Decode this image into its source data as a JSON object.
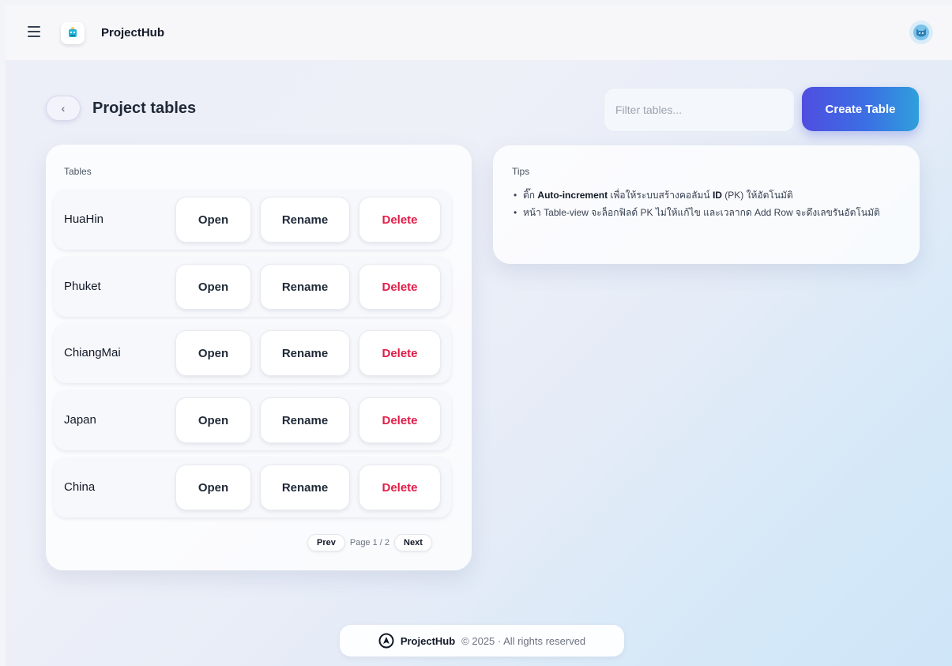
{
  "app": {
    "brand": "ProjectHub"
  },
  "header": {
    "title": "Project tables",
    "back_label": "‹",
    "filter_placeholder": "Filter tables...",
    "create_label": "Create Table"
  },
  "tables_card": {
    "label": "Tables",
    "rows": [
      {
        "name": "HuaHin",
        "open": "Open",
        "rename": "Rename",
        "delete": "Delete"
      },
      {
        "name": "Phuket",
        "open": "Open",
        "rename": "Rename",
        "delete": "Delete"
      },
      {
        "name": "ChiangMai",
        "open": "Open",
        "rename": "Rename",
        "delete": "Delete"
      },
      {
        "name": "Japan",
        "open": "Open",
        "rename": "Rename",
        "delete": "Delete"
      },
      {
        "name": "China",
        "open": "Open",
        "rename": "Rename",
        "delete": "Delete"
      }
    ],
    "pager": {
      "prev": "Prev",
      "info": "Page 1 / 2",
      "next": "Next"
    }
  },
  "tips": {
    "label": "Tips",
    "item1": {
      "t1": "ติ๊ก ",
      "b1": "Auto-increment",
      "t2": " เพื่อให้ระบบสร้างคอลัมน์ ",
      "b2": "ID",
      "t3": " (PK) ให้อัตโนมัติ"
    },
    "item2": "หน้า Table-view จะล็อกฟิลด์ PK ไม่ให้แก้ไข และเวลากด Add Row จะดึงเลขรันอัตโนมัติ"
  },
  "footer": {
    "brand": "ProjectHub",
    "copy": "© 2025 · All rights reserved"
  },
  "colors": {
    "accent_start": "#4f4ee0",
    "accent_end": "#2f9fdc",
    "delete": "#e11d48"
  }
}
